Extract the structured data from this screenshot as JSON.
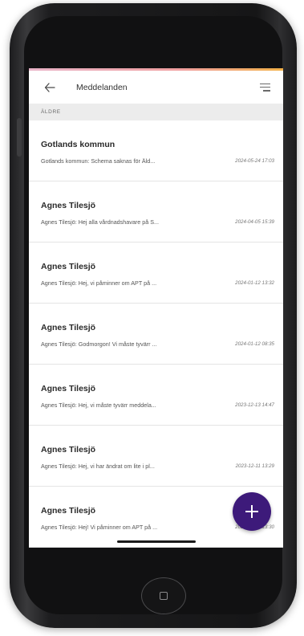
{
  "appbar": {
    "title": "Meddelanden"
  },
  "section": {
    "label": "ÄLDRE"
  },
  "messages": [
    {
      "sender": "Gotlands kommun",
      "preview": "Gotlands kommun: Schema saknas för Äld...",
      "date": "2024-05-24 17:03"
    },
    {
      "sender": "Agnes Tilesjö",
      "preview": "Agnes Tilesjö: Hej alla vårdnadshavare på S...",
      "date": "2024-04-05 15:39"
    },
    {
      "sender": "Agnes Tilesjö",
      "preview": "Agnes Tilesjö: Hej, vi påminner om APT på ...",
      "date": "2024-01-12 13:32"
    },
    {
      "sender": "Agnes Tilesjö",
      "preview": "Agnes Tilesjö: Godmorgon! Vi måste tyvärr ...",
      "date": "2024-01-12 08:35"
    },
    {
      "sender": "Agnes Tilesjö",
      "preview": "Agnes Tilesjö: Hej, vi måste tyvärr meddela...",
      "date": "2023-12-13 14:47"
    },
    {
      "sender": "Agnes Tilesjö",
      "preview": "Agnes Tilesjö: Hej, vi har ändrat om lite i pl...",
      "date": "2023-12-11 13:29"
    },
    {
      "sender": "Agnes Tilesjö",
      "preview": "Agnes Tilesjö: Hej! Vi påminner om APT på ...",
      "date": "2023-12-06 13:30"
    }
  ],
  "icons": {
    "back": "back-arrow-icon",
    "menu": "menu-icon",
    "fab": "plus-icon",
    "home": "home-button-icon"
  },
  "colors": {
    "fab": "#3d1a7a",
    "section_bg": "#ececec",
    "accent_line_start": "#e9b4c8",
    "accent_line_end": "#f3b24a"
  }
}
